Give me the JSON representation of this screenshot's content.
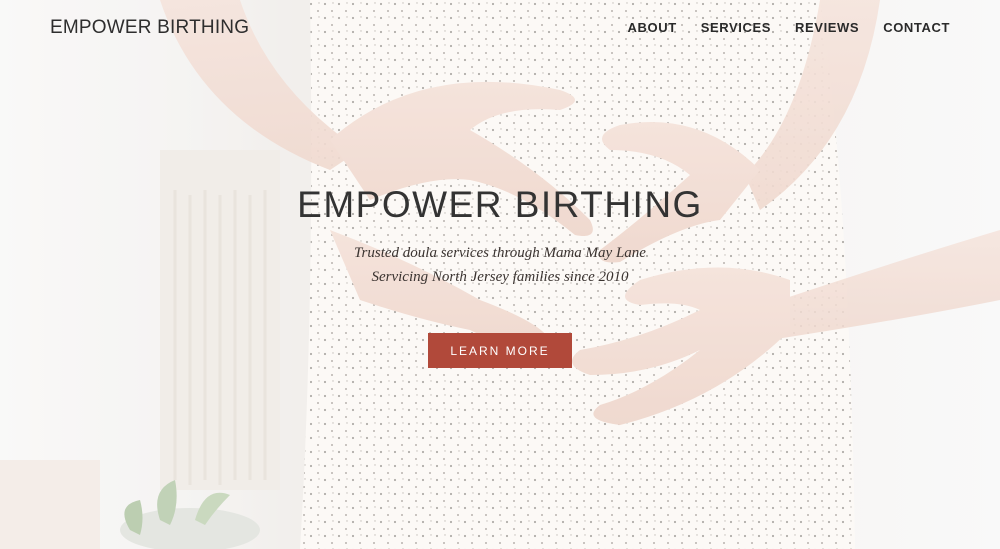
{
  "header": {
    "logo_text": "EMPOWER BIRTHING",
    "nav": [
      {
        "label": "ABOUT"
      },
      {
        "label": "SERVICES"
      },
      {
        "label": "REVIEWS"
      },
      {
        "label": "CONTACT"
      }
    ]
  },
  "hero": {
    "title": "EMPOWER BIRTHING",
    "subtitle_line1": "Trusted doula services through Mama May Lane",
    "subtitle_line2": "Servicing North Jersey families since 2010",
    "cta_label": "LEARN MORE"
  },
  "colors": {
    "accent": "#b1493a",
    "text": "#333333"
  }
}
